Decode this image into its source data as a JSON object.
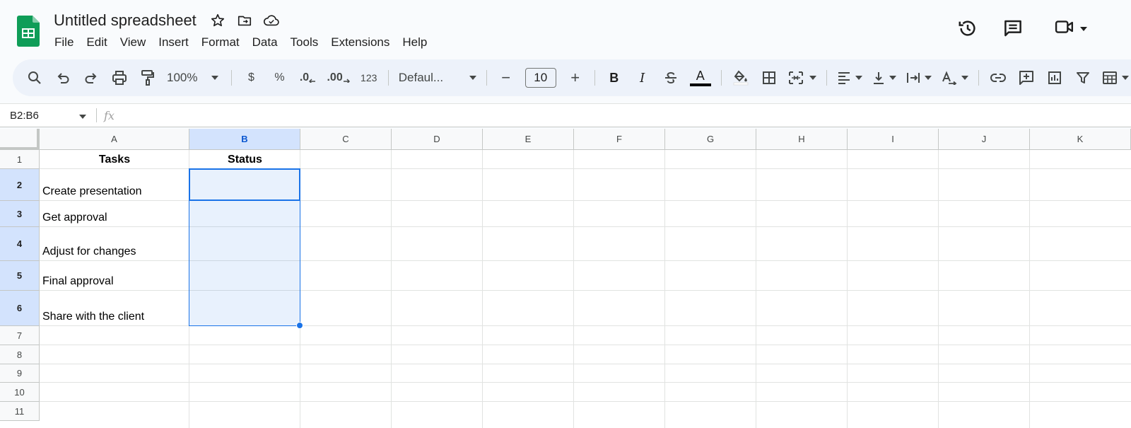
{
  "app": {
    "doc_title": "Untitled spreadsheet",
    "menu": [
      "File",
      "Edit",
      "View",
      "Insert",
      "Format",
      "Data",
      "Tools",
      "Extensions",
      "Help"
    ]
  },
  "toolbar": {
    "zoom": "100%",
    "currency": "$",
    "percent": "%",
    "dec_decrease": ".0",
    "dec_increase": ".00",
    "number_format": "123",
    "font": "Defaul...",
    "font_size": "10",
    "minus": "−",
    "plus": "+",
    "bold": "B",
    "italic": "I",
    "text_color_label": "A"
  },
  "formula_bar": {
    "name_box": "B2:B6",
    "fx": "fx"
  },
  "sheet": {
    "columns": [
      "A",
      "B",
      "C",
      "D",
      "E",
      "F",
      "G",
      "H",
      "I",
      "J",
      "K"
    ],
    "rows": [
      "1",
      "2",
      "3",
      "4",
      "5",
      "6",
      "7",
      "8",
      "9",
      "10",
      "11"
    ],
    "cells": {
      "A1": "Tasks",
      "B1": "Status",
      "A2": "Create presentation",
      "A3": "Get approval",
      "A4": "Adjust for changes",
      "A5": "Final approval",
      "A6": "Share with the client"
    }
  },
  "colors": {
    "selection": "#1a73e8",
    "header_selected": "#d3e3fd",
    "sheets_green": "#0f9d58"
  }
}
